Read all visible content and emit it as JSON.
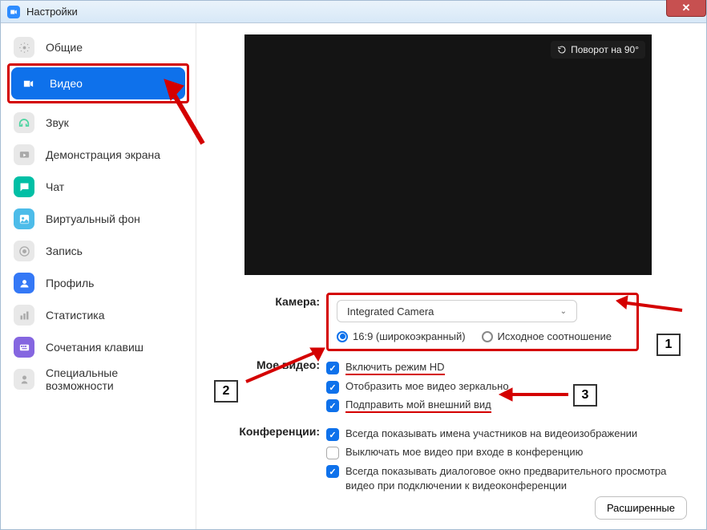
{
  "title": "Настройки",
  "closebtn": "✕",
  "sidebar": [
    {
      "label": "Общие",
      "iconBg": "#e8e8e8",
      "selected": false
    },
    {
      "label": "Видео",
      "iconBg": "#ffffff",
      "selected": true
    },
    {
      "label": "Звук",
      "iconBg": "#e8e8e8",
      "selected": false
    },
    {
      "label": "Демонстрация экрана",
      "iconBg": "#e8e8e8",
      "selected": false
    },
    {
      "label": "Чат",
      "iconBg": "#00bfa5",
      "selected": false
    },
    {
      "label": "Виртуальный фон",
      "iconBg": "#4dbce9",
      "selected": false
    },
    {
      "label": "Запись",
      "iconBg": "#e8e8e8",
      "selected": false
    },
    {
      "label": "Профиль",
      "iconBg": "#3478f6",
      "selected": false
    },
    {
      "label": "Статистика",
      "iconBg": "#e8e8e8",
      "selected": false
    },
    {
      "label": "Сочетания клавиш",
      "iconBg": "#8566e0",
      "selected": false
    },
    {
      "label": "Специальные возможности",
      "iconBg": "#e8e8e8",
      "selected": false
    }
  ],
  "rotate_label": "Поворот на 90°",
  "labels": {
    "camera": "Камера:",
    "my_video": "Мое видео:",
    "meetings": "Конференции:"
  },
  "camera_selected": "Integrated Camera",
  "aspect": {
    "wide": "16:9 (широкоэкранный)",
    "orig": "Исходное соотношение"
  },
  "video_opts": {
    "hd": "Включить режим HD",
    "mirror": "Отобразить мое видео зеркально",
    "touchup": "Подправить мой внешний вид"
  },
  "meeting_opts": {
    "names": "Всегда показывать имена участников на видеоизображении",
    "off_on_join": "Выключать мое видео при входе в конференцию",
    "preview": "Всегда показывать диалоговое окно предварительного просмотра видео при подключении к видеоконференции"
  },
  "advanced": "Расширенные",
  "ann": {
    "n1": "1",
    "n2": "2",
    "n3": "3"
  }
}
